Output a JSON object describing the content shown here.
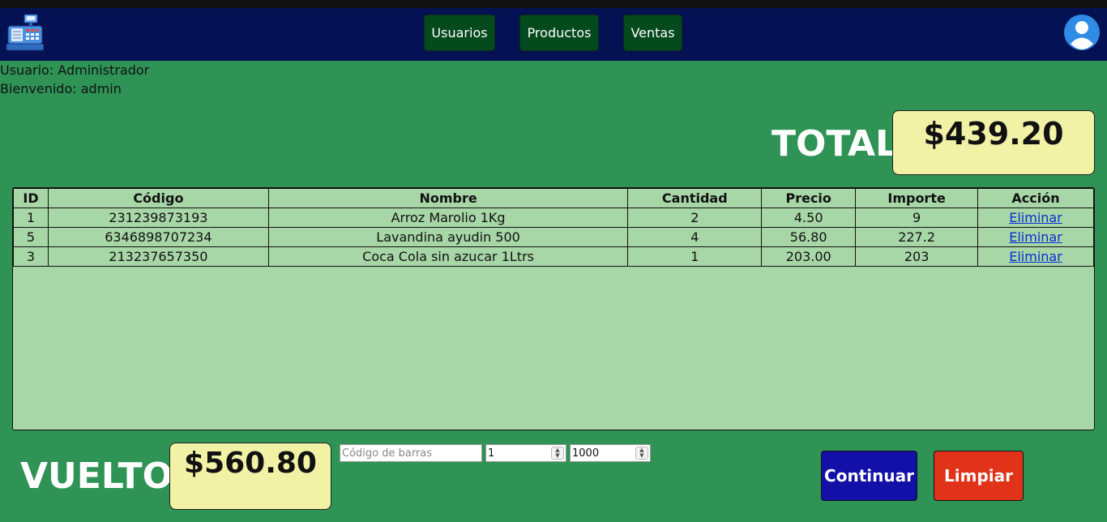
{
  "nav": {
    "usuarios": "Usuarios",
    "productos": "Productos",
    "ventas": "Ventas"
  },
  "user": {
    "role_line": "Usuario: Administrador",
    "welcome_line": "Bienvenido: admin"
  },
  "total": {
    "label": "TOTAL",
    "amount": "$439.20"
  },
  "table": {
    "headers": [
      "ID",
      "Código",
      "Nombre",
      "Cantidad",
      "Precio",
      "Importe",
      "Acción"
    ],
    "rows": [
      {
        "id": "1",
        "codigo": "231239873193",
        "nombre": "Arroz Marolio 1Kg",
        "cantidad": "2",
        "precio": "4.50",
        "importe": "9",
        "accion": "Eliminar"
      },
      {
        "id": "5",
        "codigo": "6346898707234",
        "nombre": "Lavandina ayudin 500",
        "cantidad": "4",
        "precio": "56.80",
        "importe": "227.2",
        "accion": "Eliminar"
      },
      {
        "id": "3",
        "codigo": "213237657350",
        "nombre": "Coca Cola sin azucar 1Ltrs",
        "cantidad": "1",
        "precio": "203.00",
        "importe": "203",
        "accion": "Eliminar"
      }
    ]
  },
  "vuelto": {
    "label": "VUELTO",
    "amount": "$560.80"
  },
  "inputs": {
    "barcode_placeholder": "Código de barras",
    "quantity_value": "1",
    "payment_value": "1000"
  },
  "buttons": {
    "continuar": "Continuar",
    "limpiar": "Limpiar"
  },
  "icons": {
    "logo": "cash-register-icon",
    "avatar": "user-avatar-icon",
    "spinner": "number-stepper-icon"
  },
  "colors": {
    "background": "#2e9355",
    "header": "#041254",
    "nav_button": "#054a1d",
    "amount_box": "#f2f2a6",
    "table_bg": "#a7d6a7",
    "continuar": "#1310a8",
    "limpiar": "#e0331a",
    "link": "#0a2dd6"
  }
}
